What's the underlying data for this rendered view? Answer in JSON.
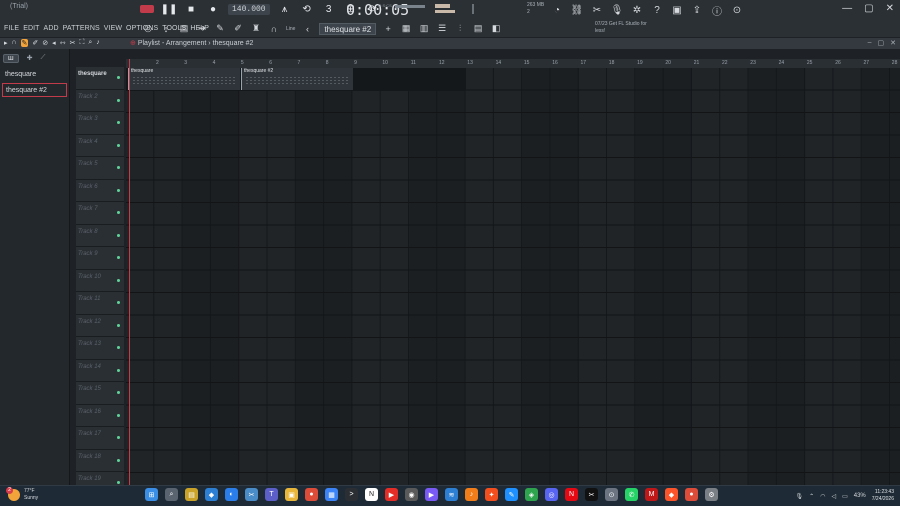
{
  "window": {
    "title": "(Trial)"
  },
  "menu": {
    "items": [
      "FILE",
      "EDIT",
      "ADD",
      "PATTERNS",
      "VIEW",
      "OPTIONS",
      "TOOLS",
      "HELP"
    ]
  },
  "transport": {
    "tempo": "140.000",
    "time": "0:00:05",
    "time_label": "M:S:CS"
  },
  "monitor": {
    "memory": "263 MB",
    "cpu": "2"
  },
  "pattern_selector": {
    "value": "thesquare #2"
  },
  "snap": {
    "value": "Line"
  },
  "hint": {
    "text": "07/23  Get FL Studio for less!"
  },
  "playlist": {
    "breadcrumb": "Playlist - Arrangement",
    "separator": "›",
    "current_pattern": "thesquare #2"
  },
  "browser": {
    "patterns": [
      {
        "label": "thesquare",
        "active": false
      },
      {
        "label": "thesquare #2",
        "active": true
      }
    ]
  },
  "ruler": {
    "bars": [
      "2",
      "3",
      "4",
      "5",
      "6",
      "7",
      "8",
      "9",
      "10",
      "11",
      "12",
      "13",
      "14",
      "15",
      "16",
      "17",
      "18",
      "19",
      "20",
      "21",
      "22",
      "23",
      "24",
      "25",
      "26",
      "27",
      "28"
    ]
  },
  "clips": [
    {
      "label": "thesquare"
    },
    {
      "label": "thesquare #2"
    }
  ],
  "tracks": [
    "thesquare",
    "Track 2",
    "Track 3",
    "Track 4",
    "Track 5",
    "Track 6",
    "Track 7",
    "Track 8",
    "Track 9",
    "Track 10",
    "Track 11",
    "Track 12",
    "Track 13",
    "Track 14",
    "Track 15",
    "Track 16",
    "Track 17",
    "Track 18",
    "Track 19"
  ],
  "taskbar": {
    "weather": {
      "temp": "77°F",
      "condition": "Sunny",
      "badge": "2"
    },
    "apps": [
      "start-icon",
      "search-icon",
      "files-icon",
      "vscode-icon",
      "edge-icon",
      "snip-icon",
      "teams-icon",
      "explorer-icon",
      "chrome-icon",
      "store-icon",
      "terminal-icon",
      "notion-icon",
      "youtube-icon",
      "obs-icon",
      "media-icon",
      "audacity-icon",
      "fl-studio-icon",
      "figma-icon",
      "paint-icon",
      "maps-icon",
      "discord-icon",
      "netflix-icon",
      "capcut-icon",
      "camera-icon",
      "whatsapp-icon",
      "mcafee-icon",
      "brave-icon",
      "chrome2-icon",
      "settings-icon"
    ],
    "battery": "43%",
    "time": "11:23:43",
    "date": "7/24/2026"
  }
}
